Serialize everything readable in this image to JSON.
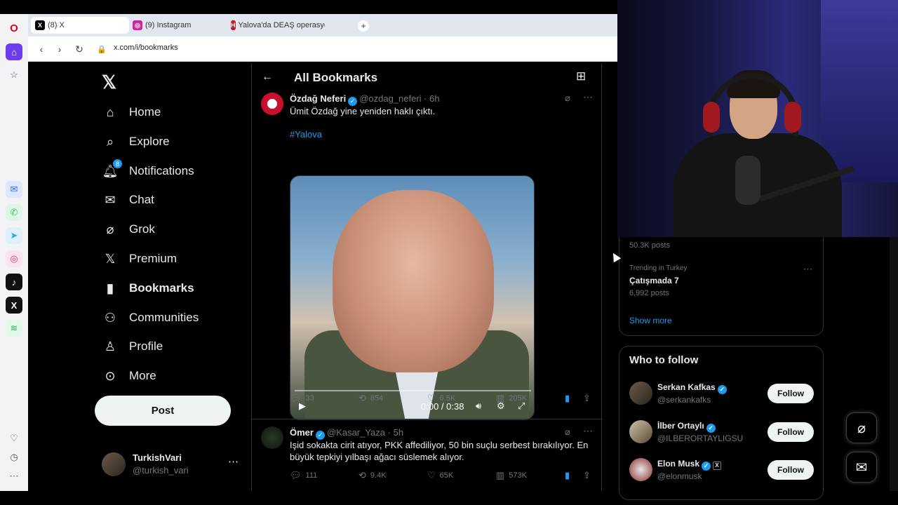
{
  "browser": {
    "tabs": [
      {
        "label": "(8) X",
        "favicon": "x-icon",
        "active": true
      },
      {
        "label": "(9) Instagram",
        "favicon": "instagram-icon",
        "active": false
      },
      {
        "label": "Yalova'da DEAŞ operasyon",
        "favicon": "haberturk-icon",
        "active": false
      }
    ],
    "new_tab": "+",
    "url": "x.com/i/bookmarks"
  },
  "sidebar": {
    "items": [
      {
        "label": "Home",
        "icon": "home-icon"
      },
      {
        "label": "Explore",
        "icon": "search-icon"
      },
      {
        "label": "Notifications",
        "icon": "bell-icon",
        "badge": "8"
      },
      {
        "label": "Chat",
        "icon": "mail-icon"
      },
      {
        "label": "Grok",
        "icon": "grok-icon"
      },
      {
        "label": "Premium",
        "icon": "x-icon"
      },
      {
        "label": "Bookmarks",
        "icon": "bookmark-icon"
      },
      {
        "label": "Communities",
        "icon": "communities-icon"
      },
      {
        "label": "Profile",
        "icon": "person-icon"
      },
      {
        "label": "More",
        "icon": "more-circle-icon"
      }
    ],
    "post_button": "Post",
    "account": {
      "name": "TurkishVari",
      "handle": "@turkish_vari"
    }
  },
  "feed": {
    "title": "All Bookmarks",
    "tweets": [
      {
        "name": "Özdağ Neferi",
        "handle": "@ozdag_neferi",
        "time": "6h",
        "text": "Ümit Özdağ yine yeniden haklı çıktı.",
        "hashtag": "#Yalova",
        "video_time": "0:00 / 0:38",
        "replies": "33",
        "reposts": "854",
        "likes": "6.5K",
        "views": "205K"
      },
      {
        "name": "Ömer",
        "handle": "@Kasar_Yaza",
        "time": "5h",
        "text": "Işid sokakta cirit atıyor, PKK affediliyor, 50 bin suçlu serbest bırakılıyor. En büyük tepkiyi yılbaşı ağacı süslemek alıyor.",
        "replies": "111",
        "reposts": "9.4K",
        "likes": "65K",
        "views": "573K"
      }
    ]
  },
  "trends": {
    "partial_posts": "50.3K posts",
    "item": {
      "context": "Trending in Turkey",
      "name": "Çatışmada 7",
      "posts": "6,992 posts"
    },
    "show_more": "Show more"
  },
  "who_to_follow": {
    "title": "Who to follow",
    "users": [
      {
        "name": "Serkan Kafkas",
        "handle": "@serkankafks"
      },
      {
        "name": "İlber Ortaylı",
        "handle": "@ILBERORTAYLIGSU"
      },
      {
        "name": "Elon Musk",
        "handle": "@elonmusk"
      }
    ],
    "follow_label": "Follow"
  }
}
